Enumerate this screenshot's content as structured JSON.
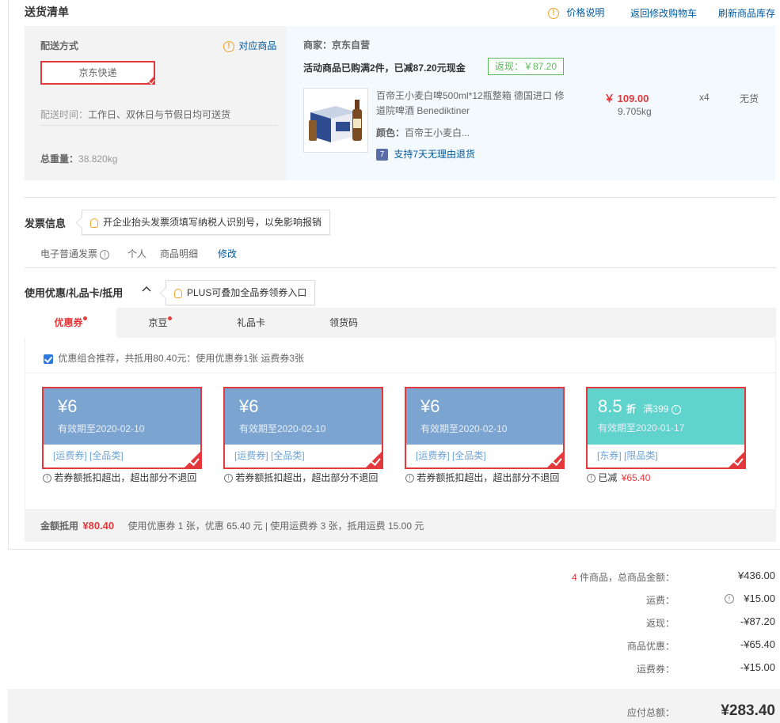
{
  "shipping": {
    "title": "送货清单",
    "links": {
      "price_info": "价格说明",
      "back_to_cart": "返回修改购物车",
      "refresh_stock": "刷新商品库存"
    },
    "delivery_method_label": "配送方式",
    "match_products": "对应商品",
    "delivery_option": "京东快递",
    "delivery_time_label": "配送时间：",
    "delivery_time_value": "工作日、双休日与节假日均可送货",
    "total_weight_label": "总重量：",
    "total_weight_value": "38.820kg"
  },
  "merchant": {
    "label": "商家：",
    "name": "京东自营",
    "promo_text": "活动商品已购满2件，已减87.20元现金",
    "rebate_badge": "返现：￥87.20",
    "product": {
      "name": "百帝王小麦白啤500ml*12瓶整箱 德国进口 修道院啤酒 Benediktiner",
      "price": "￥ 109.00",
      "weight": "9.705kg",
      "quantity": "x4",
      "stock": "无货",
      "color_label": "颜色：",
      "color_value": "百帝王小麦白...",
      "return_policy": "支持7天无理由退货",
      "return_icon": "7"
    }
  },
  "invoice": {
    "title": "发票信息",
    "tip": "开企业抬头发票须填写纳税人识别号，以免影响报销",
    "type": "电子普通发票",
    "holder": "个人",
    "content": "商品明细",
    "edit": "修改"
  },
  "coupons": {
    "title": "使用优惠/礼品卡/抵用",
    "tip": "PLUS可叠加全品券领券入口",
    "tabs": [
      {
        "label": "优惠券"
      },
      {
        "label": "京豆"
      },
      {
        "label": "礼品卡"
      },
      {
        "label": "领货码"
      }
    ],
    "recommend_text": "优惠组合推荐，共抵用80.40元：使用优惠券1张 运费券3张",
    "cards": [
      {
        "amount": "¥6",
        "valid": "有效期至2020-02-10",
        "tags": "[运费券]  [全品类]",
        "note": "若券额抵扣超出，超出部分不退回",
        "color": "#7ba5d0"
      },
      {
        "amount": "¥6",
        "valid": "有效期至2020-02-10",
        "tags": "[运费券]  [全品类]",
        "note": "若券额抵扣超出，超出部分不退回",
        "color": "#7ba5d0"
      },
      {
        "amount": "¥6",
        "valid": "有效期至2020-02-10",
        "tags": "[运费券]  [全品类]",
        "note": "若券额抵扣超出，超出部分不退回",
        "color": "#7ba5d0"
      },
      {
        "amount": "8.5",
        "discount_unit": "折",
        "condition": "满399",
        "valid": "有效期至2020-01-17",
        "tags": "[东券]  [限品类]",
        "note_prefix": "已减",
        "note_value": "¥65.40",
        "color": "#5fd3cc"
      }
    ],
    "summary_label": "金额抵用",
    "summary_value": "¥80.40",
    "summary_detail": "使用优惠券 1 张，优惠 65.40 元  | 使用运费券 3 张，抵用运费 15.00 元"
  },
  "totals": {
    "items_count": "4",
    "items_label": "件商品，总商品金额：",
    "items_value": "¥436.00",
    "shipping_label": "运费：",
    "shipping_value": "¥15.00",
    "rebate_label": "返现：",
    "rebate_value": "-¥87.20",
    "discount_label": "商品优惠：",
    "discount_value": "-¥65.40",
    "shipping_coupon_label": "运费券：",
    "shipping_coupon_value": "-¥15.00",
    "payable_label": "应付总额：",
    "payable_value": "¥283.40"
  }
}
